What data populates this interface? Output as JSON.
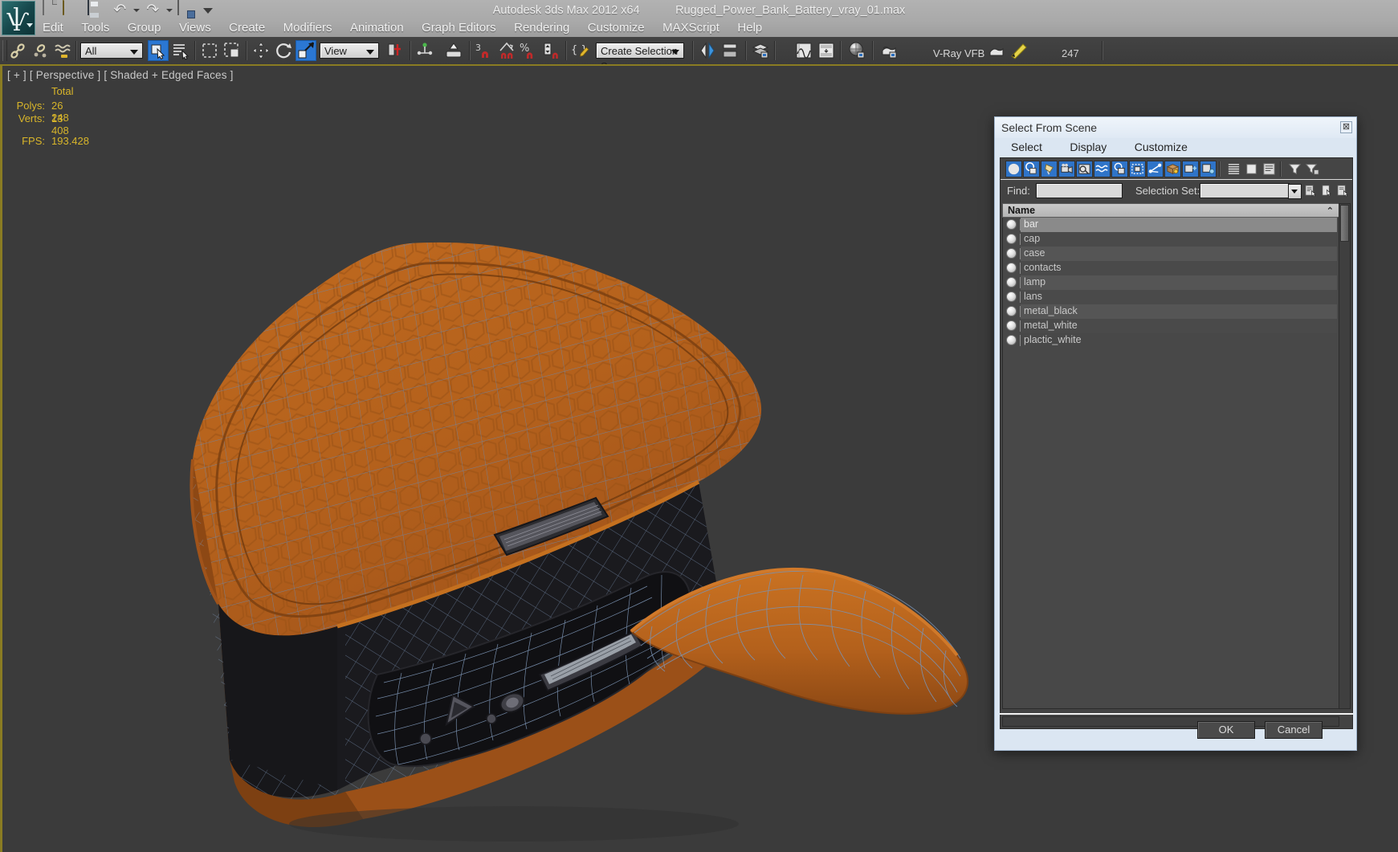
{
  "window": {
    "app_title": "Autodesk 3ds Max  2012 x64",
    "file_title": "Rugged_Power_Bank_Battery_vray_01.max"
  },
  "menubar": {
    "quick_icons": [
      "new-file-icon",
      "open-file-icon",
      "save-file-icon",
      "undo-icon",
      "undo-dropdown-icon",
      "redo-icon",
      "redo-dropdown-icon",
      "set-project-folder-icon",
      "quick-access-dropdown-icon"
    ],
    "items": [
      "Edit",
      "Tools",
      "Group",
      "Views",
      "Create",
      "Modifiers",
      "Animation",
      "Graph Editors",
      "Rendering",
      "Customize",
      "MAXScript",
      "Help"
    ]
  },
  "toolbar": {
    "selection_filter": "All",
    "reference_coord_system": "View",
    "named_selection_set": "Create Selection Se",
    "vray_vfb_label": "V-Ray VFB",
    "frame_counter": "247",
    "buttons": [
      "select-and-link-icon",
      "unlink-selection-icon",
      "bind-to-space-warp-icon",
      "select-object-icon",
      "select-by-name-icon",
      "rectangular-selection-region-icon",
      "window-crossing-icon",
      "select-and-move-icon",
      "select-and-rotate-icon",
      "select-and-scale-icon",
      "use-pivot-point-center-icon",
      "select-and-manipulate-icon",
      "snaps-toggle-icon",
      "angle-snap-toggle-icon",
      "percent-snap-toggle-icon",
      "spinner-snap-toggle-icon",
      "edit-named-selection-sets-icon",
      "mirror-icon",
      "align-icon",
      "layer-manager-icon",
      "curve-editor-icon",
      "schematic-view-icon",
      "material-editor-icon",
      "render-setup-icon",
      "rendered-frame-window-icon",
      "render-production-icon"
    ]
  },
  "viewport": {
    "label": "[ + ] [ Perspective ] [ Shaded + Edged Faces ]",
    "stats": {
      "header": "Total",
      "polys_label": "Polys:",
      "polys_value": "26 248",
      "verts_label": "Verts:",
      "verts_value": "13 408",
      "fps_label": "FPS:",
      "fps_value": "193.428"
    },
    "model_colors": {
      "body_orange": "#b4611c",
      "body_orange_dark": "#8f4a14",
      "wire_blue": "#5f7fa8",
      "inner_black": "#17171a",
      "background": "#3b3b3b"
    }
  },
  "dialog": {
    "title": "Select From Scene",
    "close_glyph": "⊠",
    "menu": [
      "Select",
      "Display",
      "Customize"
    ],
    "toolbar_icons": [
      "display-geometry-icon",
      "display-shapes-icon",
      "display-lights-icon",
      "display-cameras-icon",
      "display-helpers-icon",
      "display-space-warps-icon",
      "display-groups-icon",
      "display-xrefs-icon",
      "display-bones-icon",
      "display-containers-icon",
      "display-frozen-icon",
      "display-hidden-icon",
      "expand-all-icon",
      "collapse-all-icon",
      "list-view-icon",
      "filter-icon",
      "advanced-filter-icon"
    ],
    "find_label": "Find:",
    "find_value": "",
    "selection_set_label": "Selection Set:",
    "selection_set_value": "",
    "column_header": "Name",
    "sort_mark": "⌃",
    "items": [
      {
        "name": "bar",
        "selected": true
      },
      {
        "name": "cap",
        "selected": false
      },
      {
        "name": "case",
        "selected": false
      },
      {
        "name": "contacts",
        "selected": false
      },
      {
        "name": "lamp",
        "selected": false
      },
      {
        "name": "lans",
        "selected": false
      },
      {
        "name": "metal_black",
        "selected": false
      },
      {
        "name": "metal_white",
        "selected": false
      },
      {
        "name": "plactic_white",
        "selected": false
      }
    ],
    "ok_label": "OK",
    "cancel_label": "Cancel"
  }
}
